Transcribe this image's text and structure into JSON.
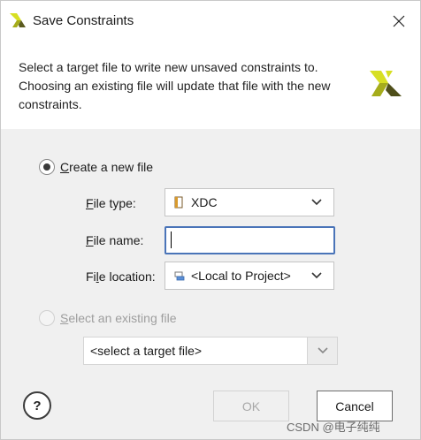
{
  "window": {
    "title": "Save Constraints",
    "close_icon": "close-icon",
    "logo_icon": "vivado-logo-icon"
  },
  "header": {
    "description": "Select a target file to write new unsaved constraints to. Choosing an existing file will update that file with the new constraints.",
    "logo_icon": "vivado-logo-icon"
  },
  "create_new": {
    "label_mnemonic": "C",
    "label_rest": "reate a new file",
    "selected": true,
    "file_type": {
      "label_mnemonic": "F",
      "label_rest": "ile type:",
      "value": "XDC",
      "icon": "xdc-file-icon"
    },
    "file_name": {
      "label_mnemonic": "F",
      "label_rest": "ile name:",
      "value": "",
      "focused": true
    },
    "file_location": {
      "label_prefix": "Fi",
      "label_mnemonic": "l",
      "label_rest": "e location:",
      "value": "<Local to Project>",
      "icon": "local-project-icon"
    }
  },
  "select_existing": {
    "label_mnemonic": "S",
    "label_rest": "elect an existing file",
    "selected": false,
    "enabled": false,
    "target_value": "<select a target file>"
  },
  "buttons": {
    "help_label": "?",
    "ok_label": "OK",
    "ok_enabled": false,
    "cancel_label": "Cancel"
  },
  "watermark": "CSDN @电子纯纯",
  "colors": {
    "focus_border": "#4a74b8",
    "body_background": "#f0f0f0",
    "logo_yellow": "#d7df23",
    "logo_dark": "#5b5b1f"
  }
}
